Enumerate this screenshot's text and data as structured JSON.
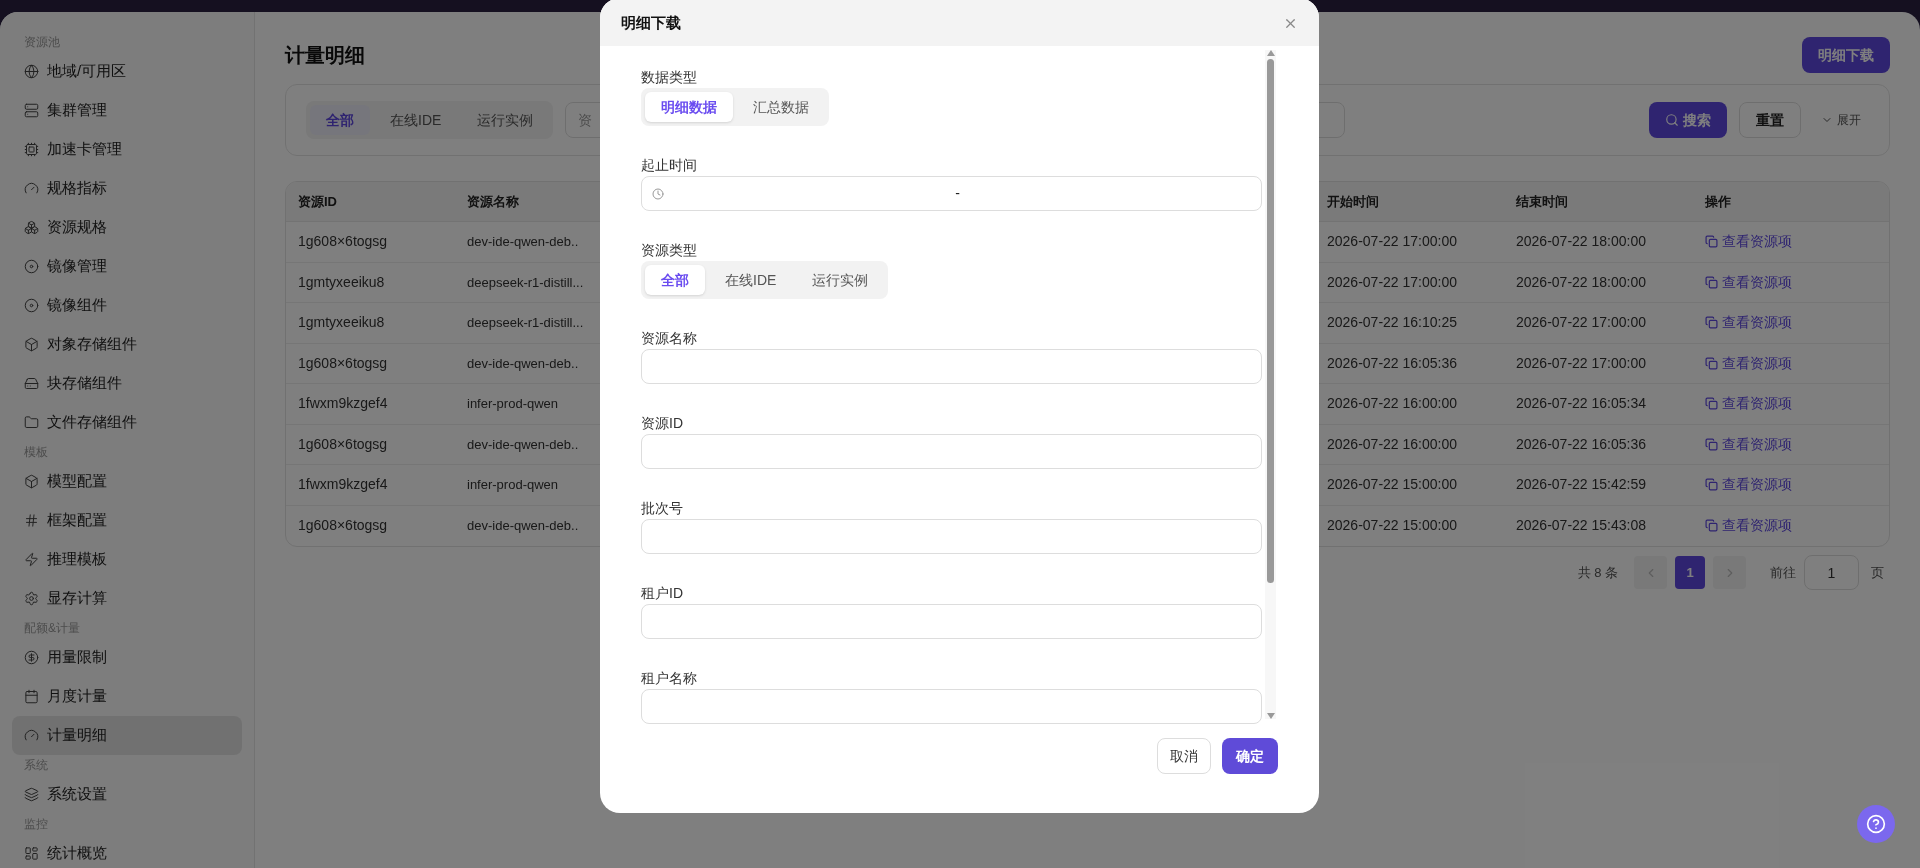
{
  "sidebar": {
    "sections": [
      {
        "title": "资源池",
        "items": [
          {
            "label": "地域/可用区",
            "selected": false
          },
          {
            "label": "集群管理",
            "selected": false
          },
          {
            "label": "加速卡管理",
            "selected": false
          },
          {
            "label": "规格指标",
            "selected": false
          },
          {
            "label": "资源规格",
            "selected": false
          },
          {
            "label": "镜像管理",
            "selected": false
          },
          {
            "label": "镜像组件",
            "selected": false
          },
          {
            "label": "对象存储组件",
            "selected": false
          },
          {
            "label": "块存储组件",
            "selected": false
          },
          {
            "label": "文件存储组件",
            "selected": false
          }
        ]
      },
      {
        "title": "模板",
        "items": [
          {
            "label": "模型配置",
            "selected": false
          },
          {
            "label": "框架配置",
            "selected": false
          },
          {
            "label": "推理模板",
            "selected": false
          },
          {
            "label": "显存计算",
            "selected": false
          }
        ]
      },
      {
        "title": "配额&计量",
        "items": [
          {
            "label": "用量限制",
            "selected": false
          },
          {
            "label": "月度计量",
            "selected": false
          },
          {
            "label": "计量明细",
            "selected": true
          }
        ]
      },
      {
        "title": "系统",
        "items": [
          {
            "label": "系统设置",
            "selected": false
          }
        ]
      },
      {
        "title": "监控",
        "items": [
          {
            "label": "统计概览",
            "selected": false
          }
        ]
      }
    ]
  },
  "page": {
    "title": "计量明细",
    "download_button": "明细下载"
  },
  "filter": {
    "tabs": [
      {
        "label": "全部",
        "selected": true
      },
      {
        "label": "在线IDE",
        "selected": false
      },
      {
        "label": "运行实例",
        "selected": false
      }
    ],
    "placeholder": "资",
    "search_button": "搜索",
    "reset_button": "重置",
    "expand_toggle": "展开"
  },
  "table": {
    "columns": [
      "资源ID",
      "资源名称",
      "开始时间",
      "结束时间",
      "操作"
    ],
    "rows": [
      {
        "id": "1g608×6togsg",
        "name": "dev-ide-qwen-deb..",
        "start": "2026-07-22 17:00:00",
        "end": "2026-07-22 18:00:00",
        "action": "查看资源项"
      },
      {
        "id": "1gmtyxeeiku8",
        "name": "deepseek-r1-distill...",
        "start": "2026-07-22 17:00:00",
        "end": "2026-07-22 18:00:00",
        "action": "查看资源项"
      },
      {
        "id": "1gmtyxeeiku8",
        "name": "deepseek-r1-distill...",
        "start": "2026-07-22 16:10:25",
        "end": "2026-07-22 17:00:00",
        "action": "查看资源项"
      },
      {
        "id": "1g608×6togsg",
        "name": "dev-ide-qwen-deb..",
        "start": "2026-07-22 16:05:36",
        "end": "2026-07-22 17:00:00",
        "action": "查看资源项"
      },
      {
        "id": "1fwxm9kzgef4",
        "name": "infer-prod-qwen",
        "start": "2026-07-22 16:00:00",
        "end": "2026-07-22 16:05:34",
        "action": "查看资源项"
      },
      {
        "id": "1g608×6togsg",
        "name": "dev-ide-qwen-deb..",
        "start": "2026-07-22 16:00:00",
        "end": "2026-07-22 16:05:36",
        "action": "查看资源项"
      },
      {
        "id": "1fwxm9kzgef4",
        "name": "infer-prod-qwen",
        "start": "2026-07-22 15:00:00",
        "end": "2026-07-22 15:42:59",
        "action": "查看资源项"
      },
      {
        "id": "1g608×6togsg",
        "name": "dev-ide-qwen-deb..",
        "start": "2026-07-22 15:00:00",
        "end": "2026-07-22 15:43:08",
        "action": "查看资源项"
      }
    ]
  },
  "pagination": {
    "total": "共 8 条",
    "pages": [
      {
        "label": "1",
        "selected": true
      }
    ],
    "goto_label": "前往",
    "goto_value": "1",
    "page_suffix": "页"
  },
  "modal": {
    "title": "明细下载",
    "fields": [
      {
        "kind": "segmented",
        "label": "数据类型",
        "options": [
          {
            "label": "明细数据",
            "selected": true
          },
          {
            "label": "汇总数据",
            "selected": false
          }
        ]
      },
      {
        "kind": "daterange",
        "label": "起止时间",
        "separator": "-"
      },
      {
        "kind": "segmented",
        "label": "资源类型",
        "options": [
          {
            "label": "全部",
            "selected": true
          },
          {
            "label": "在线IDE",
            "selected": false
          },
          {
            "label": "运行实例",
            "selected": false
          }
        ]
      },
      {
        "kind": "text",
        "label": "资源名称"
      },
      {
        "kind": "text",
        "label": "资源ID"
      },
      {
        "kind": "text",
        "label": "批次号"
      },
      {
        "kind": "text",
        "label": "租户ID"
      },
      {
        "kind": "text",
        "label": "租户名称"
      }
    ],
    "cancel_button": "取消",
    "confirm_button": "确定"
  }
}
